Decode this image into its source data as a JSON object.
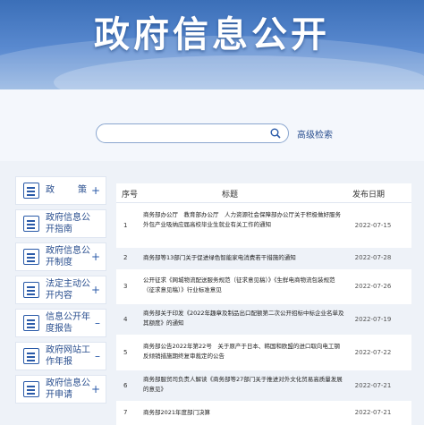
{
  "banner": {
    "title": "政府信息公开"
  },
  "search": {
    "placeholder": "",
    "advanced_label": "高级检索"
  },
  "sidebar": {
    "items": [
      {
        "label": "政　策",
        "toggle": "+"
      },
      {
        "label": "政府信息公开指南",
        "toggle": ""
      },
      {
        "label": "政府信息公开制度",
        "toggle": "+"
      },
      {
        "label": "法定主动公开内容",
        "toggle": "+"
      },
      {
        "label": "信息公开年度报告",
        "toggle": "–"
      },
      {
        "label": "政府网站工作年报",
        "toggle": "–"
      },
      {
        "label": "政府信息公开申请",
        "toggle": "+"
      }
    ]
  },
  "table": {
    "headers": {
      "no": "序号",
      "title": "标题",
      "date": "发布日期"
    },
    "rows": [
      {
        "no": "1",
        "title": "商务部办公厅　教育部办公厅　人力资源社会保障部办公厅关于积极做好服务外包产业吸纳应届高校毕业生就业有关工作的通知",
        "date": "2022-07-15"
      },
      {
        "no": "2",
        "title": "商务部等13部门关于促进绿色智能家电消费若干措施的通知",
        "date": "2022-07-28"
      },
      {
        "no": "3",
        "title": "公开征求《网城物流配送服务规范（征求意见稿）》《生鲜电商物流包装规范（征求意见稿）》行业标准意见",
        "date": "2022-07-26"
      },
      {
        "no": "4",
        "title": "商务部关于印发《2022年趣章及制品出口配额第二次公开招标中标企业名单及其额度》的通知",
        "date": "2022-07-19"
      },
      {
        "no": "5",
        "title": "商务部公告2022年第22号　关于原产于日本、韩国和欧盟的进口取向电工钢反倾销措施期终复审裁定的公告",
        "date": "2022-07-22"
      },
      {
        "no": "6",
        "title": "商务部服贸司负责人解读《商务部等27部门关于推进对外文化贸易高质量发展的意见》",
        "date": "2022-07-21"
      },
      {
        "no": "7",
        "title": "商务部2021年度部门决算",
        "date": "2022-07-21"
      }
    ]
  }
}
